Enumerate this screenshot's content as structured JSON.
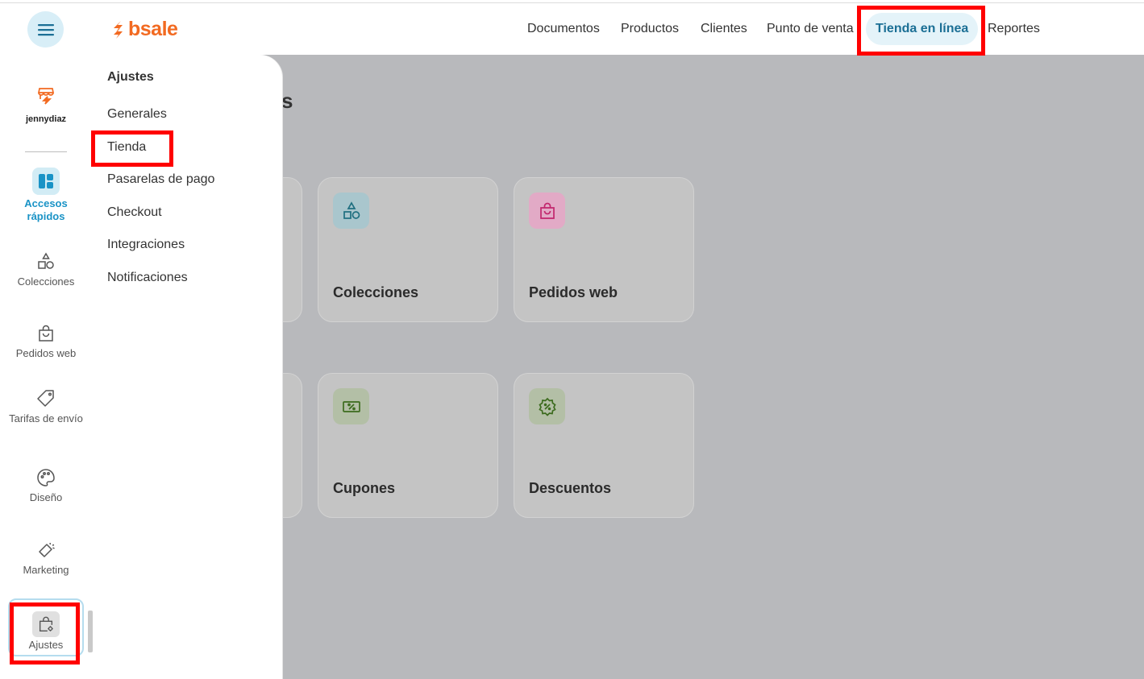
{
  "header": {
    "logo_text": "bsale",
    "nav": [
      {
        "label": "Documentos"
      },
      {
        "label": "Productos"
      },
      {
        "label": "Clientes"
      },
      {
        "label": "Punto de venta"
      },
      {
        "label": "Tienda en línea",
        "active": true
      },
      {
        "label": "Reportes"
      }
    ]
  },
  "sidebar": {
    "store": {
      "name": "jennydiaz",
      "icon": "storefront-icon"
    },
    "items": [
      {
        "label": "Accesos rápidos",
        "icon": "dashboard-icon",
        "active": true
      },
      {
        "label": "Colecciones",
        "icon": "shapes-icon"
      },
      {
        "label": "Pedidos web",
        "icon": "shopping-bag-icon"
      },
      {
        "label": "Tarifas de envío",
        "icon": "tag-icon"
      },
      {
        "label": "Diseño",
        "icon": "palette-icon"
      },
      {
        "label": "Marketing",
        "icon": "megaphone-icon"
      },
      {
        "label": "Ajustes",
        "icon": "bag-gear-icon",
        "selected": true
      }
    ]
  },
  "submenu": {
    "title": "Ajustes",
    "items": [
      {
        "label": "Generales"
      },
      {
        "label": "Tienda"
      },
      {
        "label": "Pasarelas de pago"
      },
      {
        "label": "Checkout"
      },
      {
        "label": "Integraciones"
      },
      {
        "label": "Notificaciones"
      }
    ]
  },
  "main": {
    "title_fragment": "s",
    "cards": [
      {
        "title": "Colecciones",
        "icon": "shapes-icon",
        "icon_bg": "#a9c6cd",
        "icon_color": "#1f6f80"
      },
      {
        "title": "Pedidos web",
        "icon": "shopping-bag-icon",
        "icon_bg": "#e2aac6",
        "icon_color": "#c2266d"
      },
      {
        "title": "Cupones",
        "icon": "coupon-icon",
        "icon_bg": "#b3bfa6",
        "icon_color": "#3c6b1e"
      },
      {
        "title": "Descuentos",
        "icon": "discount-badge-icon",
        "icon_bg": "#b3bfa6",
        "icon_color": "#3c6b1e"
      }
    ]
  },
  "colors": {
    "brand": "#f26a21",
    "accent": "#1b6f95",
    "highlight": "#ff0000",
    "overlay": "#b8b9bc"
  }
}
